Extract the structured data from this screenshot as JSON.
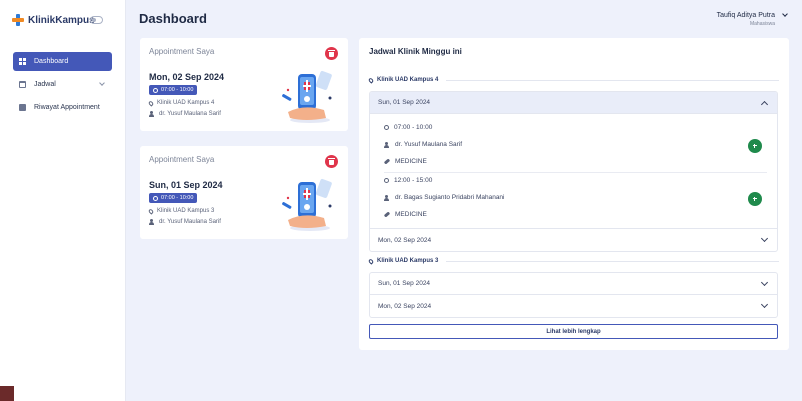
{
  "brand": {
    "name": "KlinikKampus"
  },
  "sidebar": {
    "items": [
      {
        "label": "Dashboard",
        "icon": "grid-icon"
      },
      {
        "label": "Jadwal",
        "icon": "calendar-icon"
      },
      {
        "label": "Riwayat Appointment",
        "icon": "archive-icon"
      }
    ]
  },
  "header": {
    "title": "Dashboard",
    "user_name": "Taufiq Aditya Putra",
    "user_role": "Mahasiswa"
  },
  "appointments": [
    {
      "heading": "Appointment Saya",
      "date": "Mon, 02 Sep 2024",
      "time": "07:00 - 10:00",
      "clinic": "Klinik UAD Kampus 4",
      "doctor": "dr. Yusuf Maulana Sarif"
    },
    {
      "heading": "Appointment Saya",
      "date": "Sun, 01 Sep 2024",
      "time": "07:00 - 10:00",
      "clinic": "Klinik UAD Kampus 3",
      "doctor": "dr. Yusuf Maulana Sarif"
    }
  ],
  "schedule": {
    "title": "Jadwal Klinik Minggu ini",
    "clinics": [
      {
        "name": "Klinik UAD Kampus 4",
        "days": [
          {
            "date": "Sun, 01 Sep 2024",
            "slots": [
              {
                "time": "07:00 - 10:00",
                "doctor": "dr. Yusuf Maulana Sarif",
                "category": "MEDICINE"
              },
              {
                "time": "12:00 - 15:00",
                "doctor": "dr. Bagas Sugianto Pridabri Mahanani",
                "category": "MEDICINE"
              }
            ]
          },
          {
            "date": "Mon, 02 Sep 2024"
          }
        ]
      },
      {
        "name": "Klinik UAD Kampus 3",
        "days": [
          {
            "date": "Sun, 01 Sep 2024"
          },
          {
            "date": "Mon, 02 Sep 2024"
          }
        ]
      }
    ],
    "more_label": "Lihat lebih lengkap"
  },
  "colors": {
    "primary": "#4458b8",
    "danger": "#e0354b",
    "success": "#1f8a4c",
    "background": "#eef1fb"
  }
}
